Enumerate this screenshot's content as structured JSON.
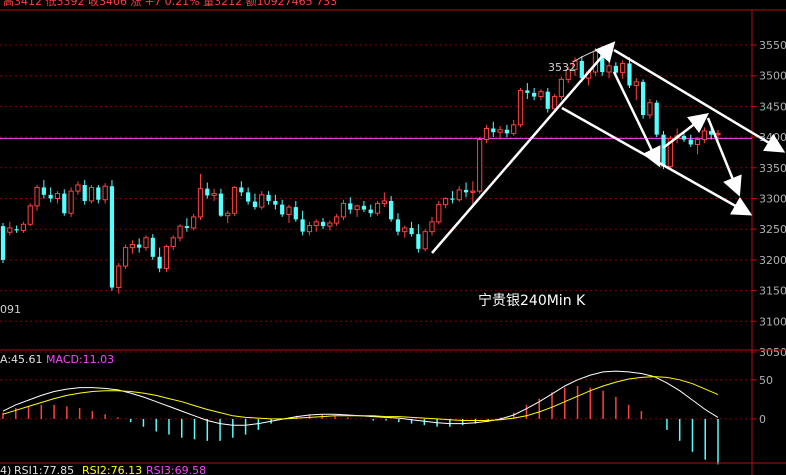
{
  "header": {
    "high_label": "高",
    "high_value": "3412",
    "low_label": "低",
    "low_value": "3392",
    "close_label": "收",
    "close_value": "3406",
    "change_label": "涨",
    "change_value": "+7",
    "change_pct": "0.21%",
    "volume_label": "量",
    "volume_value": "3212",
    "amount_label": "额",
    "amount_value": "10927465",
    "extra_value": "733"
  },
  "price_panel": {
    "title": "宁贵银240Min K",
    "y_ticks": [
      "3550",
      "3500",
      "3450",
      "3400",
      "3350",
      "3300",
      "3250",
      "3200",
      "3150",
      "3100",
      "3050"
    ],
    "ylim": [
      3050,
      3575
    ],
    "hline_value": 3398,
    "peak_label": "3532",
    "low_label": "091",
    "colors": {
      "up": "#ff4040",
      "down": "#54ffff",
      "grid": "#8b0000",
      "hline": "#ff44ff",
      "axis": "#b01010",
      "text": "#b0b0b0",
      "arrows": "#ffffff"
    }
  },
  "macd_panel": {
    "diff_label": "A:45.61",
    "macd_label": "MACD:11.03",
    "y_ticks": [
      "50",
      "0"
    ],
    "ylim": [
      -55,
      65
    ]
  },
  "rsi_panel": {
    "rsi1_label": "RSI1:77.85",
    "rsi2_label": "RSI2:76.13",
    "rsi3_label": "RSI3:69.58",
    "prefix": "4)"
  },
  "chart_data": {
    "type": "candlestick",
    "title": "宁贵银240Min K",
    "ylim": [
      3050,
      3575
    ],
    "candles": [
      [
        3255,
        3260,
        3195,
        3200
      ],
      [
        3245,
        3262,
        3240,
        3252
      ],
      [
        3250,
        3256,
        3244,
        3248
      ],
      [
        3248,
        3262,
        3244,
        3258
      ],
      [
        3258,
        3292,
        3255,
        3288
      ],
      [
        3288,
        3322,
        3280,
        3318
      ],
      [
        3318,
        3330,
        3300,
        3306
      ],
      [
        3306,
        3318,
        3294,
        3300
      ],
      [
        3300,
        3312,
        3292,
        3308
      ],
      [
        3308,
        3315,
        3272,
        3276
      ],
      [
        3276,
        3318,
        3270,
        3312
      ],
      [
        3312,
        3328,
        3306,
        3322
      ],
      [
        3322,
        3330,
        3290,
        3296
      ],
      [
        3296,
        3322,
        3292,
        3318
      ],
      [
        3318,
        3322,
        3292,
        3298
      ],
      [
        3298,
        3325,
        3292,
        3320
      ],
      [
        3320,
        3330,
        3150,
        3155
      ],
      [
        3155,
        3195,
        3145,
        3190
      ],
      [
        3190,
        3225,
        3185,
        3220
      ],
      [
        3220,
        3232,
        3210,
        3225
      ],
      [
        3225,
        3235,
        3212,
        3220
      ],
      [
        3220,
        3240,
        3215,
        3236
      ],
      [
        3236,
        3242,
        3200,
        3205
      ],
      [
        3205,
        3220,
        3180,
        3186
      ],
      [
        3186,
        3225,
        3180,
        3222
      ],
      [
        3222,
        3240,
        3216,
        3236
      ],
      [
        3236,
        3258,
        3230,
        3255
      ],
      [
        3255,
        3268,
        3246,
        3252
      ],
      [
        3252,
        3275,
        3248,
        3270
      ],
      [
        3270,
        3340,
        3265,
        3316
      ],
      [
        3316,
        3326,
        3300,
        3305
      ],
      [
        3305,
        3316,
        3296,
        3308
      ],
      [
        3308,
        3316,
        3270,
        3272
      ],
      [
        3272,
        3280,
        3260,
        3276
      ],
      [
        3276,
        3320,
        3272,
        3318
      ],
      [
        3318,
        3328,
        3304,
        3310
      ],
      [
        3310,
        3318,
        3290,
        3295
      ],
      [
        3295,
        3308,
        3282,
        3286
      ],
      [
        3286,
        3312,
        3282,
        3306
      ],
      [
        3306,
        3312,
        3290,
        3296
      ],
      [
        3296,
        3306,
        3282,
        3290
      ],
      [
        3290,
        3298,
        3270,
        3274
      ],
      [
        3274,
        3290,
        3260,
        3286
      ],
      [
        3286,
        3296,
        3262,
        3266
      ],
      [
        3266,
        3280,
        3240,
        3246
      ],
      [
        3246,
        3262,
        3240,
        3256
      ],
      [
        3256,
        3266,
        3246,
        3262
      ],
      [
        3262,
        3268,
        3250,
        3255
      ],
      [
        3255,
        3264,
        3248,
        3260
      ],
      [
        3260,
        3275,
        3255,
        3270
      ],
      [
        3270,
        3298,
        3265,
        3292
      ],
      [
        3292,
        3302,
        3275,
        3282
      ],
      [
        3282,
        3290,
        3270,
        3288
      ],
      [
        3288,
        3296,
        3278,
        3282
      ],
      [
        3282,
        3290,
        3270,
        3276
      ],
      [
        3276,
        3296,
        3272,
        3292
      ],
      [
        3292,
        3310,
        3286,
        3296
      ],
      [
        3296,
        3304,
        3262,
        3266
      ],
      [
        3266,
        3276,
        3240,
        3246
      ],
      [
        3246,
        3256,
        3236,
        3252
      ],
      [
        3252,
        3262,
        3238,
        3242
      ],
      [
        3242,
        3258,
        3212,
        3218
      ],
      [
        3218,
        3250,
        3214,
        3246
      ],
      [
        3246,
        3270,
        3240,
        3262
      ],
      [
        3262,
        3296,
        3258,
        3290
      ],
      [
        3290,
        3302,
        3284,
        3300
      ],
      [
        3300,
        3312,
        3292,
        3298
      ],
      [
        3298,
        3320,
        3295,
        3314
      ],
      [
        3314,
        3326,
        3302,
        3310
      ],
      [
        3310,
        3328,
        3290,
        3312
      ],
      [
        3312,
        3400,
        3308,
        3396
      ],
      [
        3396,
        3420,
        3390,
        3414
      ],
      [
        3414,
        3425,
        3400,
        3408
      ],
      [
        3408,
        3418,
        3396,
        3412
      ],
      [
        3412,
        3420,
        3400,
        3406
      ],
      [
        3406,
        3428,
        3402,
        3420
      ],
      [
        3420,
        3480,
        3416,
        3476
      ],
      [
        3476,
        3488,
        3462,
        3472
      ],
      [
        3472,
        3480,
        3460,
        3466
      ],
      [
        3466,
        3478,
        3460,
        3474
      ],
      [
        3474,
        3480,
        3440,
        3446
      ],
      [
        3446,
        3470,
        3440,
        3466
      ],
      [
        3466,
        3498,
        3460,
        3494
      ],
      [
        3494,
        3515,
        3488,
        3510
      ],
      [
        3510,
        3530,
        3500,
        3524
      ],
      [
        3524,
        3532,
        3490,
        3496
      ],
      [
        3496,
        3510,
        3484,
        3506
      ],
      [
        3506,
        3545,
        3500,
        3540
      ],
      [
        3540,
        3548,
        3500,
        3506
      ],
      [
        3506,
        3522,
        3496,
        3516
      ],
      [
        3516,
        3522,
        3500,
        3505
      ],
      [
        3505,
        3525,
        3495,
        3520
      ],
      [
        3520,
        3530,
        3480,
        3484
      ],
      [
        3484,
        3496,
        3460,
        3490
      ],
      [
        3490,
        3494,
        3430,
        3436
      ],
      [
        3436,
        3462,
        3430,
        3456
      ],
      [
        3456,
        3460,
        3400,
        3404
      ],
      [
        3404,
        3410,
        3348,
        3352
      ],
      [
        3352,
        3402,
        3348,
        3398
      ],
      [
        3398,
        3414,
        3390,
        3402
      ],
      [
        3402,
        3408,
        3392,
        3396
      ],
      [
        3396,
        3404,
        3384,
        3388
      ],
      [
        3388,
        3400,
        3372,
        3396
      ],
      [
        3396,
        3416,
        3390,
        3410
      ],
      [
        3410,
        3420,
        3396,
        3404
      ],
      [
        3404,
        3412,
        3392,
        3406
      ]
    ],
    "annotations": {
      "peak": 3532,
      "horizontal_line": 3398
    },
    "macd": {
      "diff": [
        10,
        18,
        24,
        30,
        35,
        38,
        40,
        40,
        39,
        37,
        33,
        28,
        22,
        16,
        10,
        4,
        -2,
        -6,
        -8,
        -8,
        -6,
        -3,
        0,
        3,
        5,
        6,
        6,
        5,
        4,
        3,
        2,
        1,
        -1,
        -3,
        -5,
        -6,
        -6,
        -5,
        -3,
        0,
        5,
        13,
        22,
        32,
        42,
        50,
        56,
        60,
        61,
        60,
        58,
        54,
        46,
        36,
        24,
        12,
        2
      ],
      "dea": [
        6,
        11,
        16,
        21,
        26,
        30,
        33,
        35,
        36,
        36,
        35,
        33,
        30,
        26,
        22,
        17,
        12,
        8,
        4,
        2,
        1,
        0,
        0,
        1,
        2,
        3,
        4,
        4,
        4,
        4,
        3,
        3,
        2,
        1,
        0,
        -1,
        -2,
        -2,
        -2,
        -1,
        1,
        4,
        9,
        15,
        22,
        29,
        36,
        42,
        47,
        51,
        53,
        54,
        53,
        50,
        45,
        38,
        31
      ],
      "bars": [
        8,
        14,
        16,
        18,
        18,
        16,
        14,
        10,
        6,
        2,
        -4,
        -10,
        -16,
        -20,
        -24,
        -26,
        -28,
        -28,
        -24,
        -20,
        -14,
        -6,
        0,
        4,
        6,
        6,
        4,
        2,
        0,
        -2,
        -2,
        -4,
        -6,
        -8,
        -10,
        -10,
        -8,
        -6,
        -2,
        2,
        8,
        18,
        26,
        34,
        40,
        42,
        40,
        36,
        28,
        18,
        10,
        0,
        -14,
        -28,
        -42,
        -52,
        -58
      ]
    }
  }
}
